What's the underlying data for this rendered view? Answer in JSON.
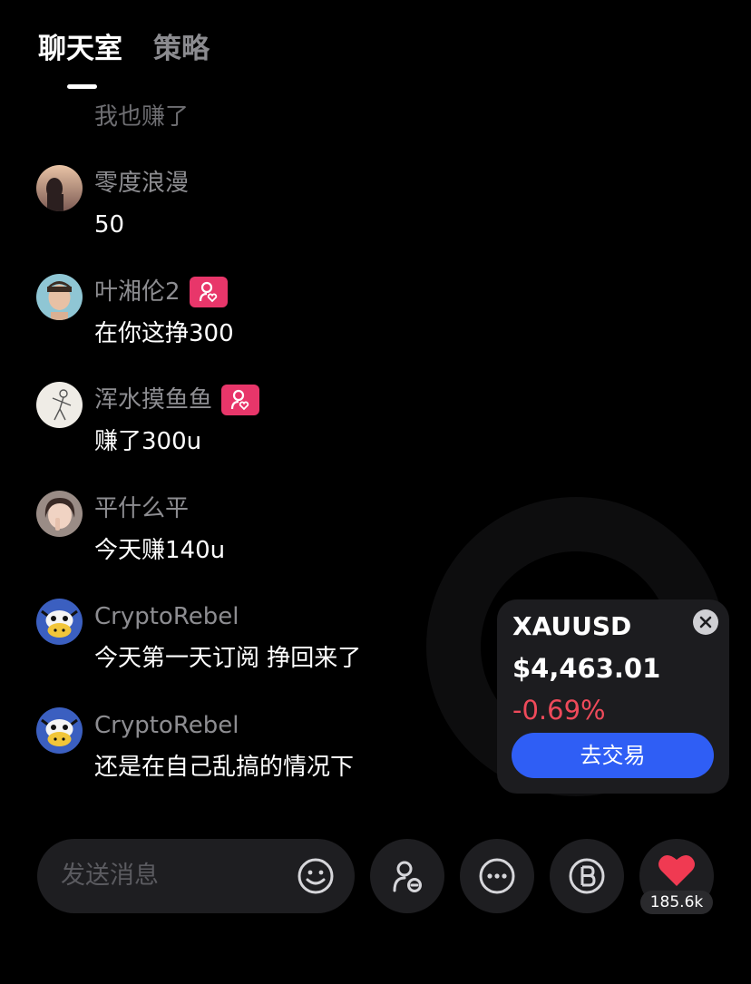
{
  "tabs": [
    {
      "label": "聊天室",
      "active": true
    },
    {
      "label": "策略",
      "active": false
    }
  ],
  "chat": {
    "partial_message": "我也赚了",
    "messages": [
      {
        "name": "零度浪漫",
        "text": "50",
        "has_badge": false,
        "avatar": "silhouette-avatar"
      },
      {
        "name": "叶湘伦2",
        "text": "在你这挣300",
        "has_badge": true,
        "avatar": "man-portrait-avatar"
      },
      {
        "name": "浑水摸鱼鱼",
        "text": "赚了300u",
        "has_badge": true,
        "avatar": "sketch-avatar"
      },
      {
        "name": "平什么平",
        "text": "今天赚140u",
        "has_badge": false,
        "avatar": "girl-portrait-avatar"
      },
      {
        "name": "CryptoRebel",
        "text": "今天第一天订阅 挣回来了",
        "has_badge": false,
        "avatar": "cow-cartoon-avatar"
      },
      {
        "name": "CryptoRebel",
        "text": "还是在自己乱搞的情况下",
        "has_badge": false,
        "avatar": "cow-cartoon-avatar"
      }
    ]
  },
  "ticker": {
    "symbol": "XAUUSD",
    "price": "$4,463.01",
    "change": "-0.69%",
    "trade_label": "去交易"
  },
  "input": {
    "placeholder": "发送消息"
  },
  "likes": {
    "count": "185.6k"
  },
  "colors": {
    "background": "#000000",
    "accent_blue": "#2f5ef5",
    "negative_red": "#ef4a5a",
    "badge_pink": "#e8366a",
    "heart_red": "#f03a52"
  },
  "icons": [
    "emoji-icon",
    "follow-user-icon",
    "more-icon",
    "b-coin-icon",
    "heart-icon",
    "close-icon",
    "follow-badge-icon"
  ]
}
